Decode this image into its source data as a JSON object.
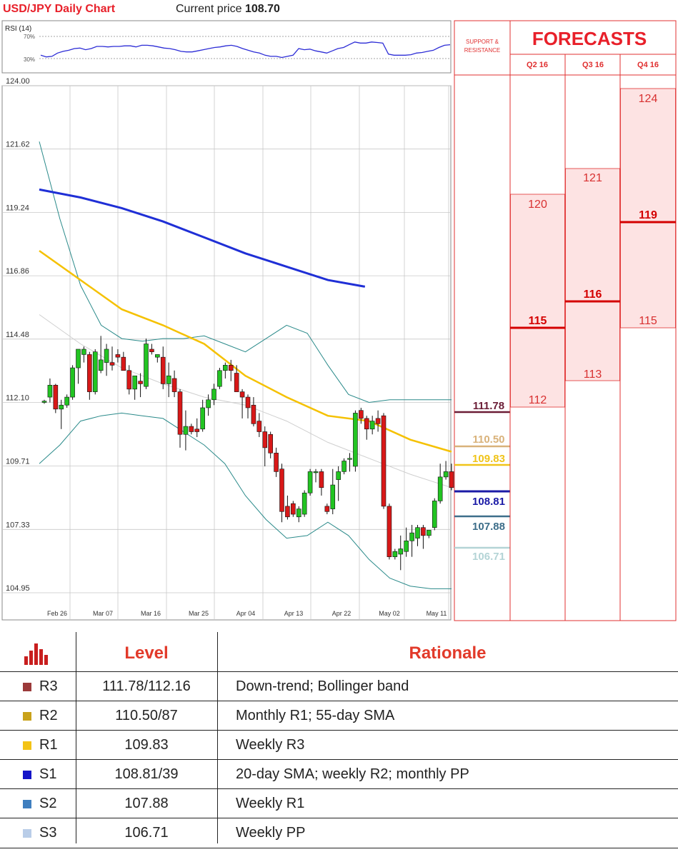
{
  "header": {
    "title": "USD/JPY Daily Chart",
    "price_label": "Current price",
    "price_value": "108.70"
  },
  "rsi": {
    "label": "RSI (14)",
    "levels": [
      "70%",
      "30%"
    ],
    "values": [
      36,
      33,
      34,
      40,
      43,
      45,
      48,
      49,
      46,
      48,
      52,
      52,
      51,
      52,
      52,
      53,
      53,
      51,
      54,
      54,
      53,
      51,
      49,
      48,
      46,
      43,
      42,
      42,
      44,
      46,
      48,
      50,
      51,
      53,
      54,
      52,
      48,
      45,
      42,
      40,
      36,
      34,
      34,
      32,
      34,
      36,
      48,
      46,
      47,
      44,
      42,
      40,
      44,
      48,
      50,
      55,
      60,
      58,
      58,
      60,
      59,
      58,
      38,
      36,
      36,
      36,
      37,
      40,
      41,
      43,
      45,
      50,
      54,
      55
    ]
  },
  "chart_data": {
    "type": "candlestick",
    "title": "USD/JPY Daily Chart",
    "ylim": [
      104.95,
      124.0
    ],
    "yticks": [
      "124.00",
      "121.62",
      "119.24",
      "116.86",
      "114.48",
      "112.10",
      "109.71",
      "107.33",
      "104.95"
    ],
    "xticks": [
      "Feb 26",
      "Mar 07",
      "Mar 16",
      "Mar 25",
      "Apr 04",
      "Apr 13",
      "Apr 22",
      "May 02",
      "May 11"
    ],
    "candles": [
      {
        "o": 112.1,
        "h": 112.2,
        "l": 112.05,
        "c": 112.15
      },
      {
        "o": 112.3,
        "h": 113.0,
        "l": 112.1,
        "c": 112.75
      },
      {
        "o": 112.75,
        "h": 112.8,
        "l": 111.7,
        "c": 111.85
      },
      {
        "o": 111.85,
        "h": 112.2,
        "l": 111.1,
        "c": 112.0
      },
      {
        "o": 112.0,
        "h": 112.4,
        "l": 111.9,
        "c": 112.3
      },
      {
        "o": 112.3,
        "h": 113.5,
        "l": 112.2,
        "c": 113.4
      },
      {
        "o": 113.4,
        "h": 113.8,
        "l": 112.8,
        "c": 114.1
      },
      {
        "o": 113.9,
        "h": 114.2,
        "l": 113.6,
        "c": 114.1
      },
      {
        "o": 113.9,
        "h": 114.0,
        "l": 112.2,
        "c": 112.5
      },
      {
        "o": 112.5,
        "h": 114.1,
        "l": 112.4,
        "c": 114.0
      },
      {
        "o": 113.3,
        "h": 114.6,
        "l": 113.2,
        "c": 113.7
      },
      {
        "o": 113.6,
        "h": 114.3,
        "l": 113.1,
        "c": 114.1
      },
      {
        "o": 113.6,
        "h": 114.2,
        "l": 113.3,
        "c": 113.5
      },
      {
        "o": 113.9,
        "h": 114.1,
        "l": 113.6,
        "c": 113.8
      },
      {
        "o": 113.8,
        "h": 114.0,
        "l": 113.4,
        "c": 113.3
      },
      {
        "o": 113.3,
        "h": 113.5,
        "l": 112.4,
        "c": 112.6
      },
      {
        "o": 112.6,
        "h": 113.1,
        "l": 112.2,
        "c": 113.1
      },
      {
        "o": 112.9,
        "h": 113.2,
        "l": 112.3,
        "c": 112.8
      },
      {
        "o": 112.7,
        "h": 114.5,
        "l": 112.6,
        "c": 114.3
      },
      {
        "o": 114.1,
        "h": 114.3,
        "l": 113.9,
        "c": 114.0
      },
      {
        "o": 113.8,
        "h": 113.9,
        "l": 113.6,
        "c": 113.9
      },
      {
        "o": 113.8,
        "h": 114.2,
        "l": 112.6,
        "c": 112.8
      },
      {
        "o": 112.8,
        "h": 113.6,
        "l": 112.3,
        "c": 113.1
      },
      {
        "o": 113.0,
        "h": 113.3,
        "l": 112.3,
        "c": 112.5
      },
      {
        "o": 112.5,
        "h": 112.6,
        "l": 110.4,
        "c": 110.9
      },
      {
        "o": 110.9,
        "h": 111.8,
        "l": 110.3,
        "c": 111.2
      },
      {
        "o": 111.2,
        "h": 111.3,
        "l": 110.9,
        "c": 111.0
      },
      {
        "o": 111.1,
        "h": 111.5,
        "l": 110.8,
        "c": 111.0
      },
      {
        "o": 111.1,
        "h": 112.2,
        "l": 111.0,
        "c": 111.9
      },
      {
        "o": 111.9,
        "h": 112.4,
        "l": 111.6,
        "c": 112.2
      },
      {
        "o": 112.2,
        "h": 112.8,
        "l": 112.0,
        "c": 112.6
      },
      {
        "o": 112.7,
        "h": 113.4,
        "l": 112.6,
        "c": 113.3
      },
      {
        "o": 113.3,
        "h": 113.6,
        "l": 113.0,
        "c": 113.5
      },
      {
        "o": 113.5,
        "h": 113.7,
        "l": 112.9,
        "c": 113.3
      },
      {
        "o": 113.2,
        "h": 113.5,
        "l": 112.5,
        "c": 112.5
      },
      {
        "o": 112.5,
        "h": 112.6,
        "l": 111.5,
        "c": 112.3
      },
      {
        "o": 112.3,
        "h": 112.4,
        "l": 111.5,
        "c": 111.9
      },
      {
        "o": 112.0,
        "h": 112.3,
        "l": 111.2,
        "c": 111.3
      },
      {
        "o": 111.4,
        "h": 111.7,
        "l": 110.8,
        "c": 111.0
      },
      {
        "o": 111.0,
        "h": 111.2,
        "l": 109.7,
        "c": 110.4
      },
      {
        "o": 110.9,
        "h": 111.0,
        "l": 110.0,
        "c": 110.2
      },
      {
        "o": 110.2,
        "h": 110.4,
        "l": 109.3,
        "c": 109.5
      },
      {
        "o": 109.6,
        "h": 109.8,
        "l": 107.6,
        "c": 108.0
      },
      {
        "o": 108.2,
        "h": 108.6,
        "l": 107.7,
        "c": 107.8
      },
      {
        "o": 108.3,
        "h": 108.4,
        "l": 107.8,
        "c": 107.9
      },
      {
        "o": 107.8,
        "h": 108.2,
        "l": 107.6,
        "c": 108.1
      },
      {
        "o": 107.9,
        "h": 108.8,
        "l": 107.8,
        "c": 108.7
      },
      {
        "o": 108.7,
        "h": 109.6,
        "l": 108.6,
        "c": 109.5
      },
      {
        "o": 109.5,
        "h": 109.6,
        "l": 109.1,
        "c": 109.5
      },
      {
        "o": 109.5,
        "h": 109.6,
        "l": 108.6,
        "c": 108.9
      },
      {
        "o": 108.2,
        "h": 108.3,
        "l": 107.9,
        "c": 108.0
      },
      {
        "o": 108.1,
        "h": 109.6,
        "l": 107.9,
        "c": 109.0
      },
      {
        "o": 109.2,
        "h": 109.7,
        "l": 108.4,
        "c": 109.5
      },
      {
        "o": 109.5,
        "h": 110.0,
        "l": 109.4,
        "c": 109.9
      },
      {
        "o": 110.0,
        "h": 110.2,
        "l": 109.5,
        "c": 110.0
      },
      {
        "o": 109.7,
        "h": 111.8,
        "l": 109.5,
        "c": 111.7
      },
      {
        "o": 111.8,
        "h": 111.9,
        "l": 111.3,
        "c": 111.5
      },
      {
        "o": 111.5,
        "h": 111.6,
        "l": 110.7,
        "c": 111.1
      },
      {
        "o": 111.1,
        "h": 111.6,
        "l": 110.9,
        "c": 111.4
      },
      {
        "o": 111.5,
        "h": 111.8,
        "l": 111.0,
        "c": 111.3
      },
      {
        "o": 111.6,
        "h": 111.7,
        "l": 108.1,
        "c": 108.2
      },
      {
        "o": 108.2,
        "h": 108.3,
        "l": 106.2,
        "c": 106.3
      },
      {
        "o": 106.3,
        "h": 106.6,
        "l": 106.2,
        "c": 106.5
      },
      {
        "o": 106.4,
        "h": 107.1,
        "l": 105.8,
        "c": 106.6
      },
      {
        "o": 106.5,
        "h": 107.4,
        "l": 106.3,
        "c": 106.9
      },
      {
        "o": 106.9,
        "h": 107.5,
        "l": 106.3,
        "c": 107.2
      },
      {
        "o": 107.0,
        "h": 107.5,
        "l": 106.7,
        "c": 107.4
      },
      {
        "o": 107.4,
        "h": 107.5,
        "l": 106.6,
        "c": 107.1
      },
      {
        "o": 107.1,
        "h": 107.3,
        "l": 107.0,
        "c": 107.3
      },
      {
        "o": 107.4,
        "h": 108.5,
        "l": 107.3,
        "c": 108.4
      },
      {
        "o": 108.4,
        "h": 109.8,
        "l": 108.3,
        "c": 109.3
      },
      {
        "o": 109.3,
        "h": 109.9,
        "l": 109.2,
        "c": 109.5
      },
      {
        "o": 109.5,
        "h": 109.8,
        "l": 108.8,
        "c": 108.9
      }
    ],
    "sma200": [
      [
        0,
        120.1
      ],
      [
        10,
        119.8
      ],
      [
        20,
        119.4
      ],
      [
        30,
        118.9
      ],
      [
        40,
        118.3
      ],
      [
        50,
        117.7
      ],
      [
        60,
        117.2
      ],
      [
        70,
        116.7
      ],
      [
        79,
        116.45
      ]
    ],
    "sma55": [
      [
        0,
        117.8
      ],
      [
        10,
        116.7
      ],
      [
        20,
        115.6
      ],
      [
        30,
        115.0
      ],
      [
        40,
        114.3
      ],
      [
        50,
        113.1
      ],
      [
        60,
        112.3
      ],
      [
        70,
        111.6
      ],
      [
        80,
        111.4
      ],
      [
        90,
        110.7
      ],
      [
        100,
        110.25
      ]
    ],
    "bb_upper": [
      [
        0,
        121.9
      ],
      [
        5,
        119.0
      ],
      [
        10,
        116.5
      ],
      [
        15,
        115.0
      ],
      [
        20,
        114.5
      ],
      [
        25,
        114.4
      ],
      [
        30,
        114.5
      ],
      [
        35,
        114.5
      ],
      [
        40,
        114.6
      ],
      [
        45,
        114.3
      ],
      [
        50,
        114.0
      ],
      [
        55,
        114.5
      ],
      [
        60,
        115.0
      ],
      [
        65,
        114.7
      ],
      [
        70,
        113.5
      ],
      [
        75,
        112.4
      ],
      [
        80,
        112.1
      ],
      [
        85,
        112.2
      ],
      [
        90,
        112.2
      ],
      [
        95,
        112.2
      ],
      [
        100,
        112.2
      ]
    ],
    "bb_lower": [
      [
        0,
        109.8
      ],
      [
        5,
        110.5
      ],
      [
        10,
        111.4
      ],
      [
        15,
        111.6
      ],
      [
        20,
        111.7
      ],
      [
        25,
        111.6
      ],
      [
        30,
        111.5
      ],
      [
        35,
        111.0
      ],
      [
        40,
        110.5
      ],
      [
        45,
        109.8
      ],
      [
        50,
        108.6
      ],
      [
        55,
        107.7
      ],
      [
        60,
        107.0
      ],
      [
        65,
        107.1
      ],
      [
        70,
        107.6
      ],
      [
        75,
        107.1
      ],
      [
        80,
        106.2
      ],
      [
        85,
        105.5
      ],
      [
        90,
        105.2
      ],
      [
        95,
        105.1
      ],
      [
        100,
        105.1
      ]
    ],
    "sma20": [
      [
        0,
        115.4
      ],
      [
        10,
        114.3
      ],
      [
        20,
        113.4
      ],
      [
        30,
        112.8
      ],
      [
        40,
        112.3
      ],
      [
        50,
        112.0
      ],
      [
        60,
        111.4
      ],
      [
        70,
        110.6
      ],
      [
        80,
        110.0
      ],
      [
        90,
        109.4
      ],
      [
        100,
        108.9
      ]
    ]
  },
  "levels": [
    {
      "value": "111.78",
      "color": "#6b1d36"
    },
    {
      "value": "110.50",
      "color": "#d9b27a"
    },
    {
      "value": "109.83",
      "color": "#f0c419"
    },
    {
      "value": "108.81",
      "color": "#1a1aa6"
    },
    {
      "value": "107.88",
      "color": "#3d6e8a"
    },
    {
      "value": "106.71",
      "color": "#b4d4d6"
    }
  ],
  "forecasts": {
    "title": "FORECASTS",
    "sr_label_1": "SUPPORT &",
    "sr_label_2": "RESISTANCE",
    "columns": [
      {
        "label": "Q2 16",
        "high": "120",
        "mid": "115",
        "low": "112"
      },
      {
        "label": "Q3 16",
        "high": "121",
        "mid": "116",
        "low": "113"
      },
      {
        "label": "Q4 16",
        "high": "124",
        "mid": "119",
        "low": "115"
      }
    ]
  },
  "table": {
    "icon": "bar-chart-icon",
    "header_level": "Level",
    "header_rationale": "Rationale",
    "rows": [
      {
        "name": "R3",
        "level": "111.78/112.16",
        "rationale": "Down-trend; Bollinger band",
        "color": "#9b3a3a"
      },
      {
        "name": "R2",
        "level": "110.50/87",
        "rationale": "Monthly R1; 55-day SMA",
        "color": "#c9a21a"
      },
      {
        "name": "R1",
        "level": "109.83",
        "rationale": "Weekly R3",
        "color": "#f3c316"
      },
      {
        "name": "S1",
        "level": "108.81/39",
        "rationale": "20-day SMA; weekly R2; monthly PP",
        "color": "#1414c8"
      },
      {
        "name": "S2",
        "level": "107.88",
        "rationale": "Weekly R1",
        "color": "#3f7fbf"
      },
      {
        "name": "S3",
        "level": "106.71",
        "rationale": "Weekly PP",
        "color": "#b9cde8"
      }
    ]
  }
}
